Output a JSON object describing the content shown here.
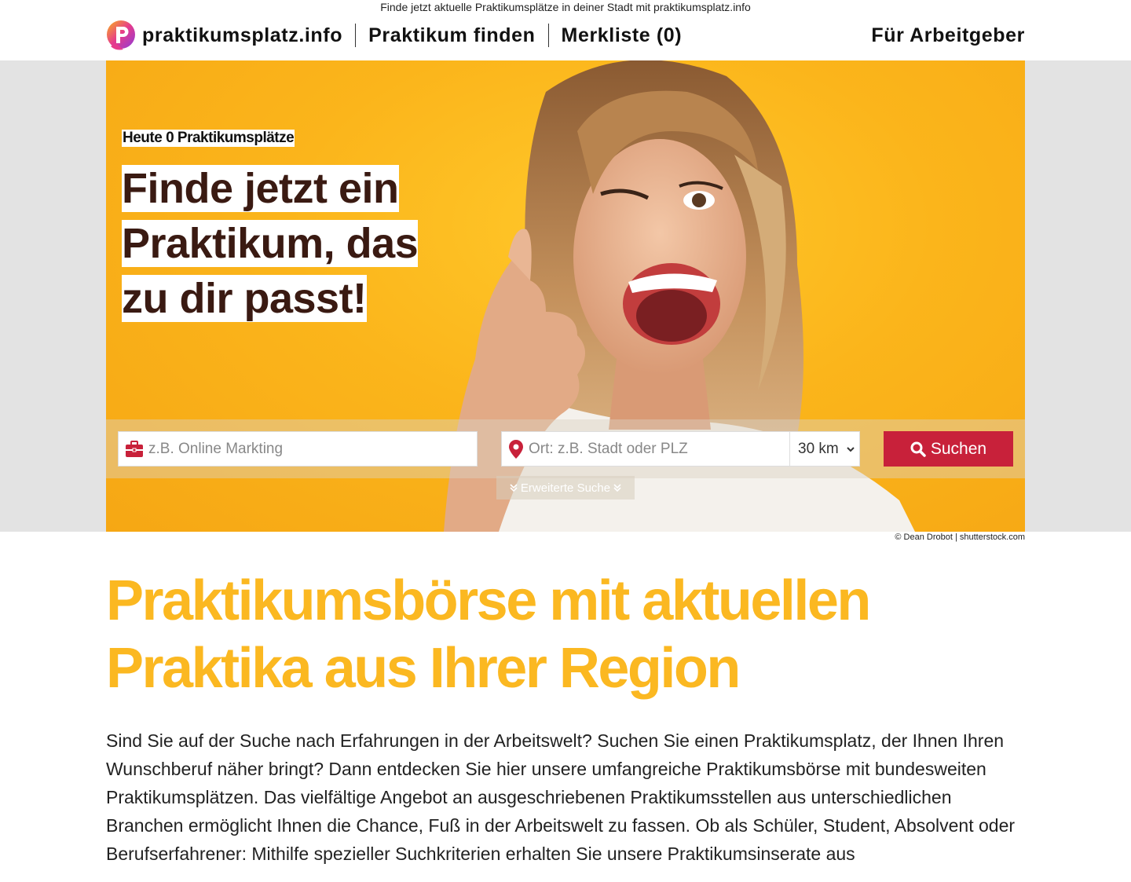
{
  "topline": "Finde jetzt aktuelle Praktikumsplätze in deiner Stadt mit praktikumsplatz.info",
  "nav": {
    "logo_text": "praktikumsplatz.info",
    "find": "Praktikum finden",
    "watchlist": "Merkliste (0)",
    "employers": "Für Arbeitgeber"
  },
  "hero": {
    "today": "Heute 0 Praktikumsplätze",
    "headline": [
      "Finde jetzt ein",
      "Praktikum, das",
      "zu dir passt!"
    ],
    "search": {
      "what_placeholder": "z.B. Online Markting",
      "where_placeholder": "Ort: z.B. Stadt oder PLZ",
      "radius": "30 km",
      "button": "Suchen",
      "advanced": "Erweiterte Suche"
    },
    "credit": "© Dean Drobot | shutterstock.com"
  },
  "main": {
    "title": "Praktikumsbörse mit aktuellen Praktika aus Ihrer Region",
    "intro": "Sind Sie auf der Suche nach Erfahrungen in der Arbeitswelt? Suchen Sie einen Praktikumsplatz, der Ihnen Ihren Wunschberuf näher bringt? Dann entdecken Sie hier unsere umfangreiche Praktikumsbörse mit bundesweiten Praktikumsplätzen. Das vielfältige Angebot an ausgeschriebenen Praktikumsstellen aus unterschiedlichen Branchen ermöglicht Ihnen die Chance, Fuß in der Arbeitswelt zu fassen. Ob als Schüler, Student, Absolvent oder Berufserfahrener: Mithilfe spezieller Suchkriterien erhalten Sie unsere Praktikumsinserate aus"
  },
  "colors": {
    "brand_yellow": "#fbb821",
    "button_red": "#c8213a",
    "headline_brown": "#3a1a12"
  }
}
